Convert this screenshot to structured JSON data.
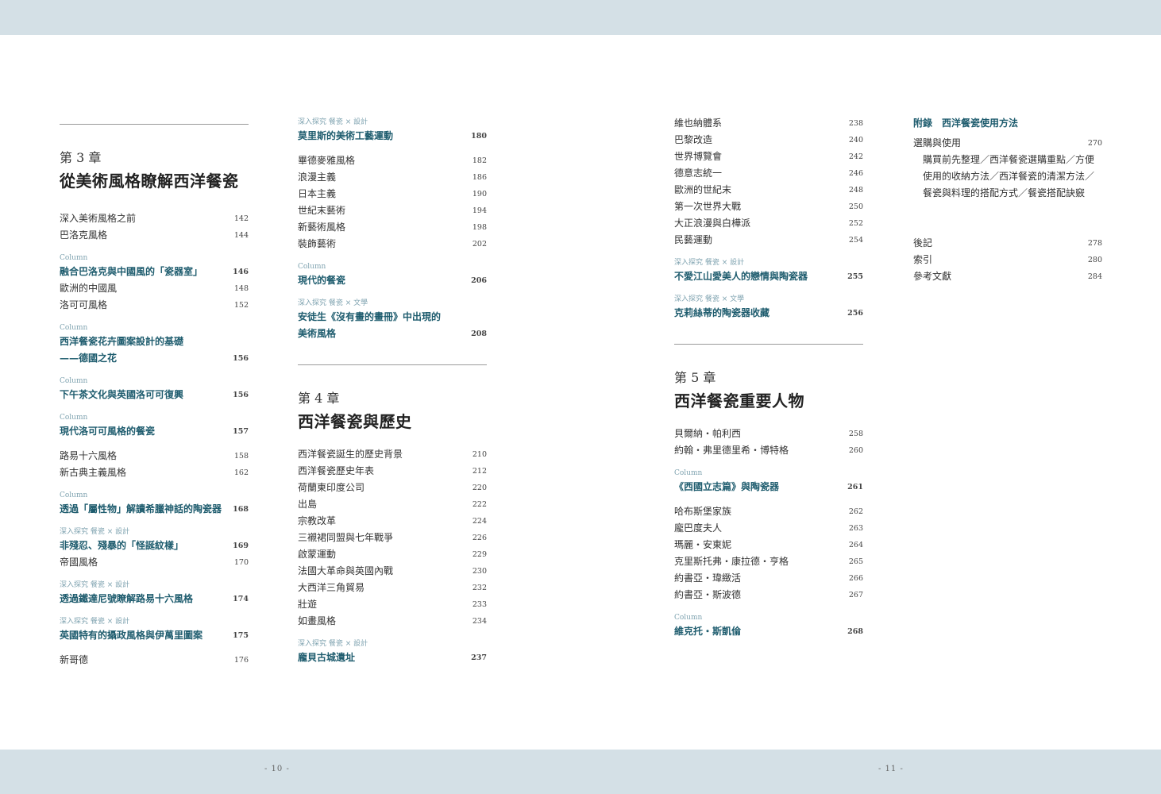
{
  "folios": {
    "left": "- 10 -",
    "right": "- 11 -"
  },
  "col1": {
    "chapter_num": "第 3 章",
    "chapter_title": "從美術風格瞭解西洋餐瓷",
    "items": [
      {
        "t": "深入美術風格之前",
        "p": "142"
      },
      {
        "t": "巴洛克風格",
        "p": "144"
      },
      {
        "l": "Column",
        "t": "融合巴洛克與中國風的「瓷器室」",
        "p": "146",
        "hl": true
      },
      {
        "t": "歐洲的中國風",
        "p": "148"
      },
      {
        "t": "洛可可風格",
        "p": "152"
      },
      {
        "l": "Column",
        "t": "西洋餐瓷花卉圖案設計的基礎",
        "t2": "——德國之花",
        "p": "156",
        "hl": true
      },
      {
        "l": "Column",
        "t": "下午茶文化與英國洛可可復興",
        "p": "156",
        "hl": true
      },
      {
        "l": "Column",
        "t": "現代洛可可風格的餐瓷",
        "p": "157",
        "hl": true
      },
      {
        "t": "路易十六風格",
        "p": "158",
        "gap": true
      },
      {
        "t": "新古典主義風格",
        "p": "162"
      },
      {
        "l": "Column",
        "t": "透過「屬性物」解讀希臘神話的陶瓷器",
        "p": "168",
        "hl": true
      },
      {
        "l": "深入探究 餐瓷 × 設計",
        "t": "非殘忍、殘暴的「怪誕紋樣」",
        "p": "169",
        "hl": true
      },
      {
        "t": "帝國風格",
        "p": "170"
      },
      {
        "l": "深入探究 餐瓷 × 設計",
        "t": "透過鐵達尼號瞭解路易十六風格",
        "p": "174",
        "hl": true
      },
      {
        "l": "深入探究 餐瓷 × 設計",
        "t": "英國特有的攝政風格與伊萬里圖案",
        "p": "175",
        "hl": true
      },
      {
        "t": "新哥德",
        "p": "176",
        "gap": true
      }
    ]
  },
  "col2": {
    "top_items": [
      {
        "l": "深入探究 餐瓷 × 設計",
        "t": "莫里斯的美術工藝運動",
        "p": "180",
        "hl": true
      },
      {
        "t": "畢德麥雅風格",
        "p": "182",
        "gap": true
      },
      {
        "t": "浪漫主義",
        "p": "186"
      },
      {
        "t": "日本主義",
        "p": "190"
      },
      {
        "t": "世紀末藝術",
        "p": "194"
      },
      {
        "t": "新藝術風格",
        "p": "198"
      },
      {
        "t": "裝飾藝術",
        "p": "202"
      },
      {
        "l": "Column",
        "t": "現代的餐瓷",
        "p": "206",
        "hl": true
      },
      {
        "l": "深入探究 餐瓷 × 文學",
        "t": "安徒生《沒有畫的畫冊》中出現的",
        "t2": "美術風格",
        "p": "208",
        "hl": true
      }
    ],
    "chapter_num": "第 4 章",
    "chapter_title": "西洋餐瓷與歷史",
    "items": [
      {
        "t": "西洋餐瓷誕生的歷史背景",
        "p": "210"
      },
      {
        "t": "西洋餐瓷歷史年表",
        "p": "212"
      },
      {
        "t": "荷蘭東印度公司",
        "p": "220"
      },
      {
        "t": "出島",
        "p": "222"
      },
      {
        "t": "宗教改革",
        "p": "224"
      },
      {
        "t": "三襯裙同盟與七年戰爭",
        "p": "226"
      },
      {
        "t": "啟蒙運動",
        "p": "229"
      },
      {
        "t": "法國大革命與英國內戰",
        "p": "230"
      },
      {
        "t": "大西洋三角貿易",
        "p": "232"
      },
      {
        "t": "壯遊",
        "p": "233"
      },
      {
        "t": "如畫風格",
        "p": "234"
      },
      {
        "l": "深入探究 餐瓷 × 設計",
        "t": "龐貝古城遺址",
        "p": "237",
        "hl": true
      }
    ]
  },
  "col3": {
    "top_items": [
      {
        "t": "維也納體系",
        "p": "238"
      },
      {
        "t": "巴黎改造",
        "p": "240"
      },
      {
        "t": "世界博覽會",
        "p": "242"
      },
      {
        "t": "德意志統一",
        "p": "246"
      },
      {
        "t": "歐洲的世紀末",
        "p": "248"
      },
      {
        "t": "第一次世界大戰",
        "p": "250"
      },
      {
        "t": "大正浪漫與白樺派",
        "p": "252"
      },
      {
        "t": "民藝運動",
        "p": "254"
      },
      {
        "l": "深入探究 餐瓷 × 設計",
        "t": "不愛江山愛美人的戀情與陶瓷器",
        "p": "255",
        "hl": true
      },
      {
        "l": "深入探究 餐瓷 × 文學",
        "t": "克莉絲蒂的陶瓷器收藏",
        "p": "256",
        "hl": true
      }
    ],
    "chapter_num": "第 5 章",
    "chapter_title": "西洋餐瓷重要人物",
    "items": [
      {
        "t": "貝爾納・帕利西",
        "p": "258"
      },
      {
        "t": "約翰・弗里德里希・博特格",
        "p": "260"
      },
      {
        "l": "Column",
        "t": "《西國立志篇》與陶瓷器",
        "p": "261",
        "hl": true
      },
      {
        "t": "哈布斯堡家族",
        "p": "262",
        "gap": true
      },
      {
        "t": "龐巴度夫人",
        "p": "263"
      },
      {
        "t": "瑪麗・安東妮",
        "p": "264"
      },
      {
        "t": "克里斯托弗・康拉德・亨格",
        "p": "265"
      },
      {
        "t": "約書亞・瑋緻活",
        "p": "266"
      },
      {
        "t": "約書亞・斯波德",
        "p": "267"
      },
      {
        "l": "Column",
        "t": "維克托・斯凱倫",
        "p": "268",
        "hl": true
      }
    ]
  },
  "col4": {
    "appendix_title": "附錄　西洋餐瓷使用方法",
    "appendix_item": {
      "t": "選購與使用",
      "p": "270"
    },
    "appendix_sub": "購買前先整理／西洋餐瓷選購重點／方便使用的收納方法／西洋餐瓷的清潔方法／餐瓷與料理的搭配方式／餐瓷搭配訣竅",
    "back_items": [
      {
        "t": "後記",
        "p": "278"
      },
      {
        "t": "索引",
        "p": "280"
      },
      {
        "t": "參考文獻",
        "p": "284"
      }
    ]
  }
}
